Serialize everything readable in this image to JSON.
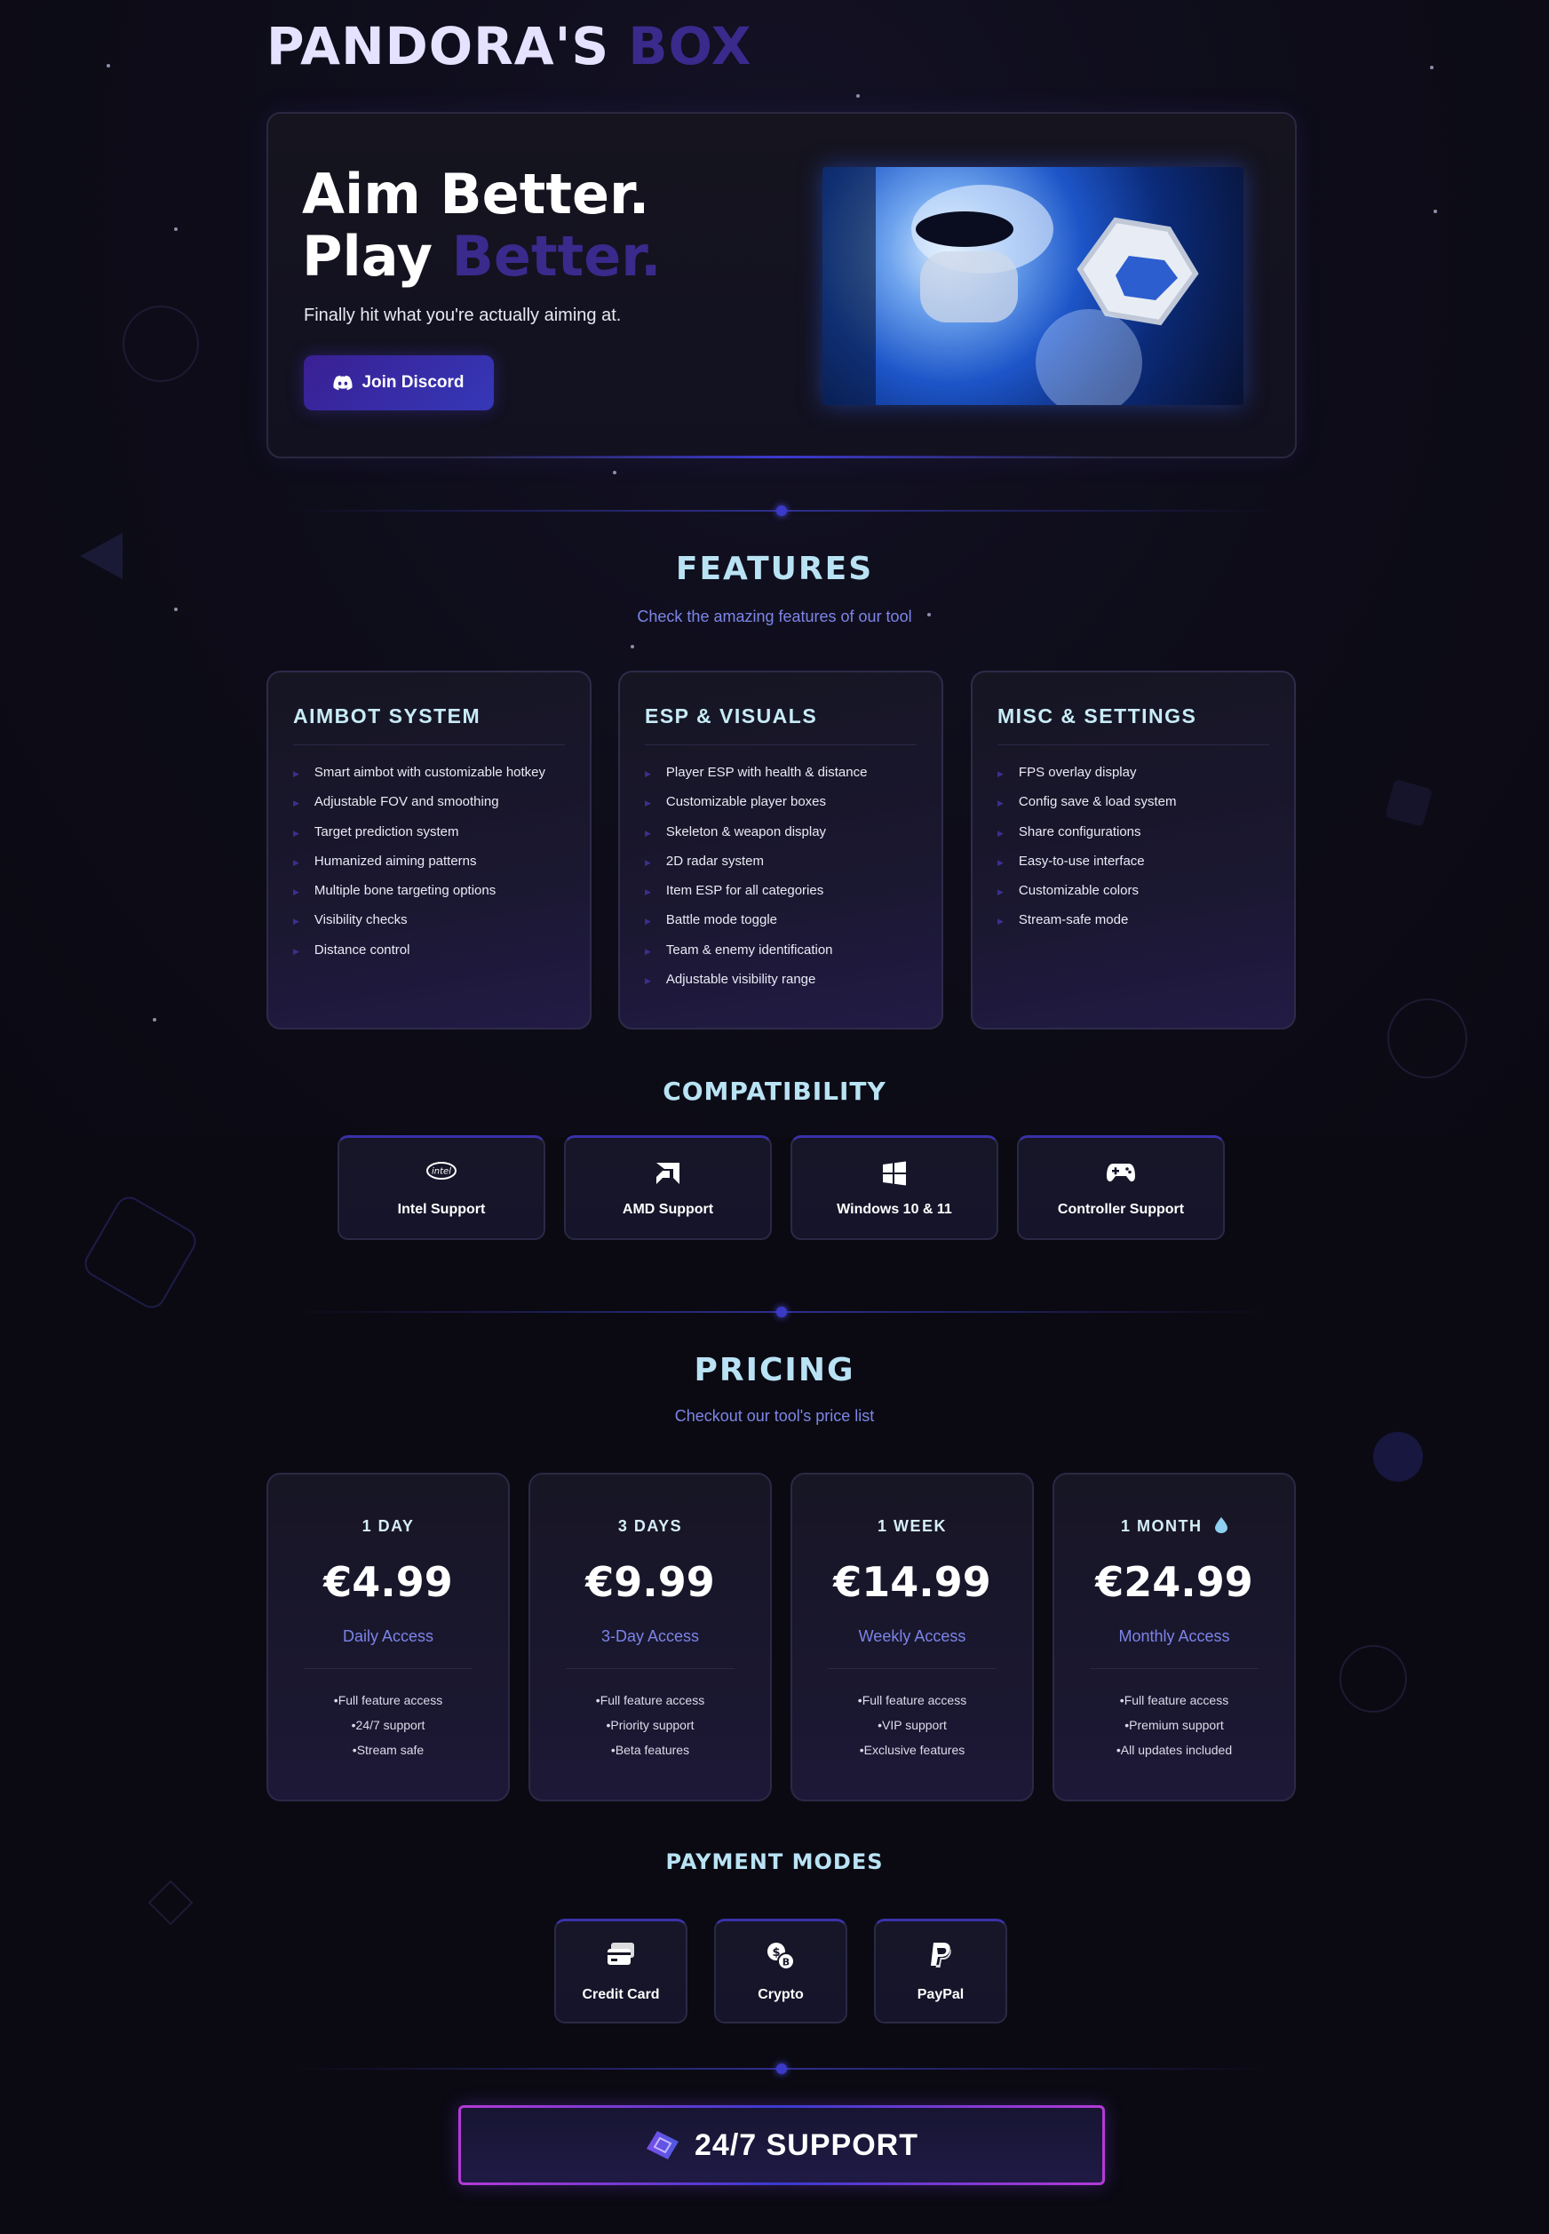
{
  "brand": {
    "name_main": "PANDORA'S",
    "name_accent": "BOX"
  },
  "hero": {
    "headline_line1": "Aim Better.",
    "headline_line2_main": "Play",
    "headline_line2_accent": "Better.",
    "subtitle": "Finally hit what you're actually aiming at.",
    "cta_label": "Join Discord",
    "cta_icon": "discord-icon"
  },
  "features": {
    "title": "FEATURES",
    "subtitle": "Check the amazing features of our tool",
    "cards": [
      {
        "title": "AIMBOT SYSTEM",
        "items": [
          "Smart aimbot with customizable hotkey",
          "Adjustable FOV and smoothing",
          "Target prediction system",
          "Humanized aiming patterns",
          "Multiple bone targeting options",
          "Visibility checks",
          "Distance control"
        ]
      },
      {
        "title": "ESP & VISUALS",
        "items": [
          "Player ESP with health & distance",
          "Customizable player boxes",
          "Skeleton & weapon display",
          "2D radar system",
          "Item ESP for all categories",
          "Battle mode toggle",
          "Team & enemy identification",
          "Adjustable visibility range"
        ]
      },
      {
        "title": "MISC & SETTINGS",
        "items": [
          "FPS overlay display",
          "Config save & load system",
          "Share configurations",
          "Easy-to-use interface",
          "Customizable colors",
          "Stream-safe mode"
        ]
      }
    ]
  },
  "compatibility": {
    "title": "COMPATIBILITY",
    "items": [
      {
        "label": "Intel Support",
        "icon": "intel-icon"
      },
      {
        "label": "AMD Support",
        "icon": "amd-icon"
      },
      {
        "label": "Windows 10 & 11",
        "icon": "windows-icon"
      },
      {
        "label": "Controller Support",
        "icon": "gamepad-icon"
      }
    ]
  },
  "pricing": {
    "title": "PRICING",
    "subtitle": "Checkout our tool's price list",
    "plans": [
      {
        "period": "1 DAY",
        "price": "€4.99",
        "desc": "Daily Access",
        "perks": [
          "Full feature access",
          "24/7 support",
          "Stream safe"
        ]
      },
      {
        "period": "3 DAYS",
        "price": "€9.99",
        "desc": "3-Day Access",
        "perks": [
          "Full feature access",
          "Priority support",
          "Beta features"
        ]
      },
      {
        "period": "1 WEEK",
        "price": "€14.99",
        "desc": "Weekly Access",
        "perks": [
          "Full feature access",
          "VIP support",
          "Exclusive features"
        ]
      },
      {
        "period": "1 MONTH",
        "price": "€24.99",
        "desc": "Monthly Access",
        "perks": [
          "Full feature access",
          "Premium support",
          "All updates included"
        ],
        "badge_icon": "water-drop-icon"
      }
    ]
  },
  "payment": {
    "title": "PAYMENT MODES",
    "methods": [
      {
        "label": "Credit Card",
        "icon": "credit-card-icon"
      },
      {
        "label": "Crypto",
        "icon": "crypto-icon"
      },
      {
        "label": "PayPal",
        "icon": "paypal-icon"
      }
    ]
  },
  "support": {
    "label": "24/7 SUPPORT",
    "icon": "ticket-icon"
  },
  "colors": {
    "accent": "#3a2a8c",
    "title_cyan": "#b9e3f4",
    "link_blue": "#7c84e8",
    "bg": "#0b0a13"
  }
}
